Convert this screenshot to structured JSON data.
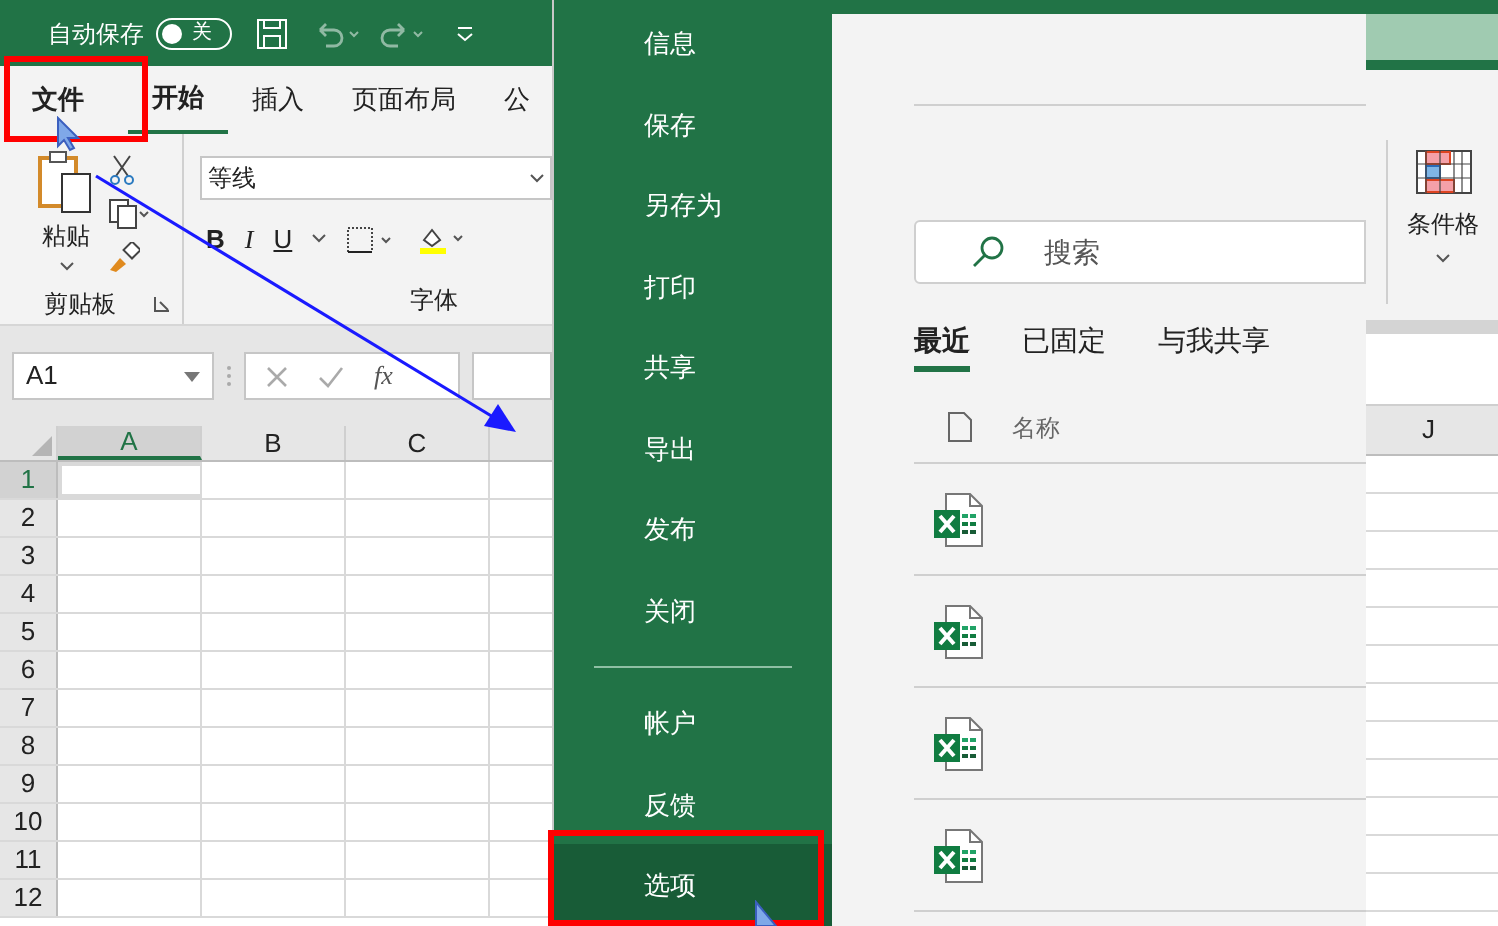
{
  "title_bar": {
    "autosave_label": "自动保存",
    "autosave_toggle": {
      "on": false,
      "label": "关"
    }
  },
  "ribbon_tabs": [
    {
      "label": "文件",
      "selected": false
    },
    {
      "label": "开始",
      "selected": true
    },
    {
      "label": "插入",
      "selected": false
    },
    {
      "label": "页面布局",
      "selected": false
    },
    {
      "label": "公",
      "selected": false
    }
  ],
  "clipboard_group": {
    "paste_label": "粘贴",
    "label": "剪贴板"
  },
  "font_group": {
    "font_name": "等线",
    "label": "字体",
    "bold": "B",
    "italic": "I",
    "underline": "U"
  },
  "formula_bar": {
    "name_box": "A1",
    "function_label": "fx"
  },
  "sheet": {
    "columns": [
      {
        "label": "A",
        "selected": true
      },
      {
        "label": "B",
        "selected": false
      },
      {
        "label": "C",
        "selected": false
      }
    ],
    "rows": [
      {
        "label": "1",
        "selected": true
      },
      {
        "label": "2",
        "selected": false
      },
      {
        "label": "3",
        "selected": false
      },
      {
        "label": "4",
        "selected": false
      },
      {
        "label": "5",
        "selected": false
      },
      {
        "label": "6",
        "selected": false
      },
      {
        "label": "7",
        "selected": false
      },
      {
        "label": "8",
        "selected": false
      },
      {
        "label": "9",
        "selected": false
      },
      {
        "label": "10",
        "selected": false
      },
      {
        "label": "11",
        "selected": false
      },
      {
        "label": "12",
        "selected": false
      }
    ]
  },
  "file_menu": {
    "items": [
      {
        "label": "信息",
        "selected": false
      },
      {
        "label": "保存",
        "selected": false
      },
      {
        "label": "另存为",
        "selected": false
      },
      {
        "label": "打印",
        "selected": false
      },
      {
        "label": "共享",
        "selected": false
      },
      {
        "label": "导出",
        "selected": false
      },
      {
        "label": "发布",
        "selected": false
      },
      {
        "label": "关闭",
        "selected": false
      }
    ],
    "bottom_items": [
      {
        "label": "帐户",
        "selected": false
      },
      {
        "label": "反馈",
        "selected": false
      },
      {
        "label": "选项",
        "selected": true
      }
    ]
  },
  "backstage": {
    "search": {
      "placeholder": "搜索"
    },
    "tabs": [
      {
        "label": "最近",
        "selected": true
      },
      {
        "label": "已固定",
        "selected": false
      },
      {
        "label": "与我共享",
        "selected": false
      }
    ],
    "name_header": "名称",
    "files": [
      {
        "kind": "excel"
      },
      {
        "kind": "excel"
      },
      {
        "kind": "excel"
      },
      {
        "kind": "excel"
      }
    ]
  },
  "right_ribbon": {
    "conditional_format_label": "条件格",
    "column_label": "J"
  }
}
